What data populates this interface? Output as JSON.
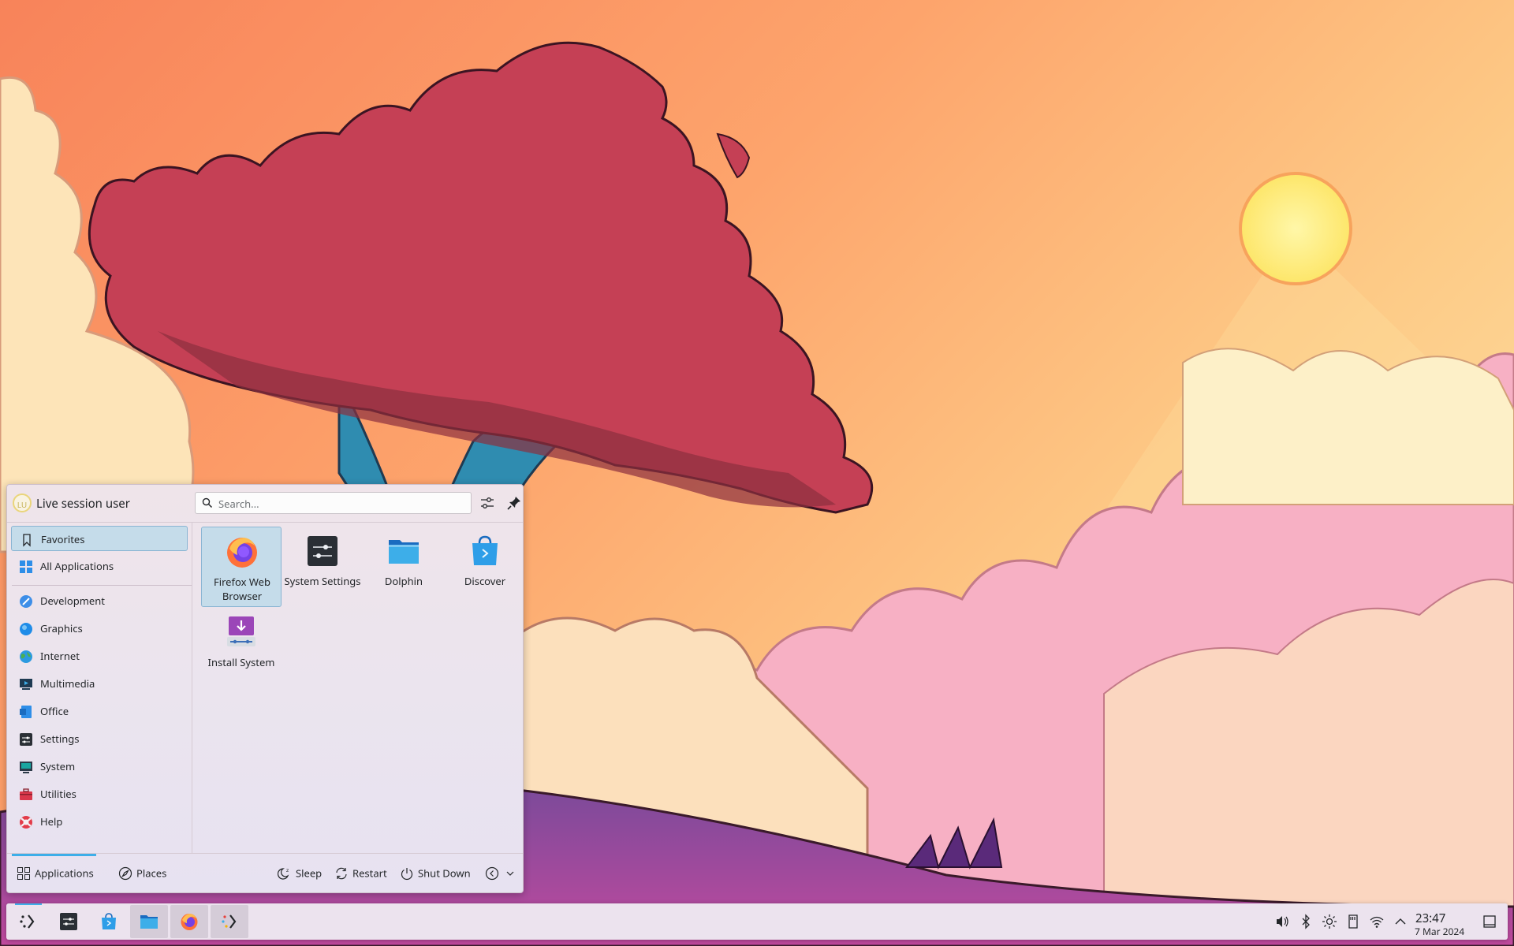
{
  "user": {
    "name": "Live session user",
    "avatar_initials": "LU"
  },
  "search": {
    "placeholder": "Search..."
  },
  "sidebar": {
    "items": [
      {
        "label": "Favorites",
        "icon": "bookmark-icon",
        "active": true
      },
      {
        "label": "All Applications",
        "icon": "grid-icon"
      },
      {
        "label": "Development",
        "icon": "development-icon"
      },
      {
        "label": "Graphics",
        "icon": "graphics-icon"
      },
      {
        "label": "Internet",
        "icon": "globe-icon"
      },
      {
        "label": "Multimedia",
        "icon": "multimedia-icon"
      },
      {
        "label": "Office",
        "icon": "office-icon"
      },
      {
        "label": "Settings",
        "icon": "settings-icon"
      },
      {
        "label": "System",
        "icon": "system-icon"
      },
      {
        "label": "Utilities",
        "icon": "toolbox-icon"
      },
      {
        "label": "Help",
        "icon": "help-icon"
      }
    ]
  },
  "favorites": [
    {
      "label": "Firefox Web Browser",
      "icon": "firefox-icon",
      "active": true
    },
    {
      "label": "System Settings",
      "icon": "system-settings-icon"
    },
    {
      "label": "Dolphin",
      "icon": "folder-icon"
    },
    {
      "label": "Discover",
      "icon": "discover-icon"
    },
    {
      "label": "Install System",
      "icon": "install-icon"
    }
  ],
  "footer": {
    "tabs": [
      {
        "label": "Applications",
        "icon": "grid-icon",
        "active": true
      },
      {
        "label": "Places",
        "icon": "compass-icon"
      }
    ],
    "actions": [
      {
        "label": "Sleep",
        "icon": "sleep-icon"
      },
      {
        "label": "Restart",
        "icon": "restart-icon"
      },
      {
        "label": "Shut Down",
        "icon": "power-icon"
      }
    ]
  },
  "taskbar": {
    "tasks": [
      "kde-launcher-icon",
      "system-settings-icon",
      "discover-icon",
      "dolphin-icon",
      "firefox-icon",
      "install-system-icon"
    ],
    "tray": [
      "volume-icon",
      "bluetooth-icon",
      "brightness-icon",
      "storage-icon",
      "wifi-icon",
      "expand-tray-icon"
    ],
    "clock_time": "23:47",
    "clock_date": "7 Mar 2024"
  },
  "colors": {
    "accent": "#3daee9",
    "selection_bg": "#c5dcea"
  }
}
